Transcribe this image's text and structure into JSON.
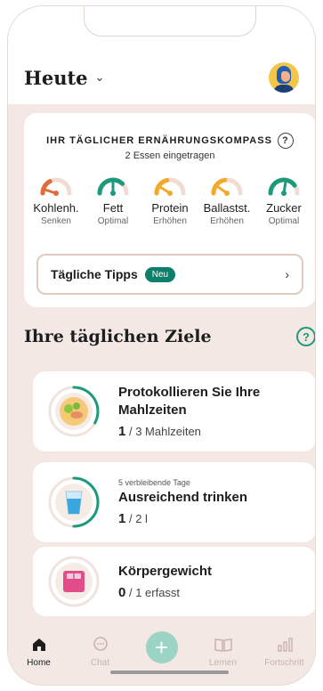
{
  "header": {
    "title": "Heute",
    "avatar": "avatar-icon"
  },
  "compass": {
    "title": "IHR TÄGLICHER ERNÄHRUNGSKOMPASS",
    "subtitle": "2 Essen eingetragen",
    "gauges": [
      {
        "label": "Kohlenh.",
        "status": "Senken",
        "color": "#e36a3a",
        "level": 0.1
      },
      {
        "label": "Fett",
        "status": "Optimal",
        "color": "#1d9a7c",
        "level": 0.5
      },
      {
        "label": "Protein",
        "status": "Erhöhen",
        "color": "#f3a92a",
        "level": 0.18
      },
      {
        "label": "Ballastst.",
        "status": "Erhöhen",
        "color": "#f3a92a",
        "level": 0.2
      },
      {
        "label": "Zucker",
        "status": "Optimal",
        "color": "#1d9a7c",
        "level": 0.55
      }
    ],
    "tips": {
      "label": "Tägliche Tipps",
      "badge": "Neu"
    }
  },
  "goals": {
    "title": "Ihre täglichen Ziele",
    "items": [
      {
        "title": "Protokollieren Sie Ihre Mahlzeiten",
        "value": "1",
        "rest": "/ 3 Mahlzeiten",
        "progress": 0.33,
        "icon": "plate-icon"
      },
      {
        "subtitle": "5 verbleibende Tage",
        "title": "Ausreichend trinken",
        "value": "1",
        "rest": "/ 2 l",
        "progress": 0.5,
        "icon": "water-glass-icon"
      },
      {
        "title": "Körpergewicht",
        "value": "0",
        "rest": "/ 1 erfasst",
        "progress": 0,
        "icon": "scale-icon"
      }
    ]
  },
  "nav": {
    "home": "Home",
    "chat": "Chat",
    "learn": "Lernen",
    "progress": "Fortschritt"
  },
  "colors": {
    "accent": "#1d9a7c",
    "background": "#f3e8e3",
    "badge": "#0d7f6a"
  }
}
